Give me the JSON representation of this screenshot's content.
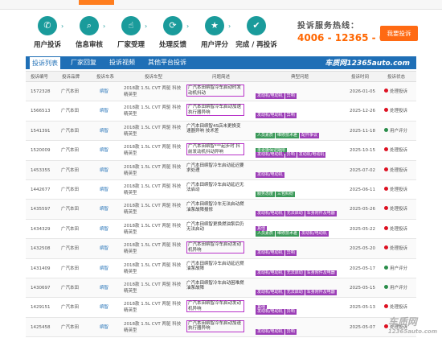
{
  "process": {
    "steps": [
      {
        "label": "用户投诉",
        "icon": "phone-icon"
      },
      {
        "label": "信息审核",
        "icon": "search-icon"
      },
      {
        "label": "厂家受理",
        "icon": "hand-icon"
      },
      {
        "label": "处理反馈",
        "icon": "refresh-icon"
      },
      {
        "label": "用户评分",
        "icon": "star-icon"
      },
      {
        "label": "完成 / 再投诉",
        "icon": "check-icon"
      }
    ],
    "hotline_title": "投诉服务热线：",
    "hotline_number": "4006 - 12365 - 0",
    "complain_button": "我要投诉"
  },
  "tabs": [
    "投诉列表",
    "厂家回复",
    "投诉视频",
    "其他平台投诉"
  ],
  "brand": "车质网12365auto.com",
  "columns": [
    "投诉编号",
    "投诉品牌",
    "投诉车系",
    "投诉车型",
    "问题简述",
    "典型问题",
    "投诉时间",
    "投诉状态"
  ],
  "rows": [
    {
      "id": "1572328",
      "brand": "广汽本田",
      "series": "缤智",
      "model": "2018款 1.5L CVT 两驱 科技精英型",
      "issue": "广汽本田缤智冷车启动时发动机抖动",
      "hl": true,
      "tags": [
        {
          "t": "发动机/电动机",
          "c": "purple"
        },
        {
          "t": "异响",
          "c": "purple"
        }
      ],
      "date": "2026-01-05",
      "status": "处理投诉"
    },
    {
      "id": "1566513",
      "brand": "广汽本田",
      "series": "缤智",
      "model": "2018款 1.5L CVT 两驱 科技精英型",
      "issue": "广汽本田缤智冷车启动加速执行器异响",
      "hl": true,
      "tags": [
        {
          "t": "发动机/电动机",
          "c": "purple"
        },
        {
          "t": "异响",
          "c": "purple"
        }
      ],
      "date": "2025-12-26",
      "status": "处理投诉"
    },
    {
      "id": "1541391",
      "brand": "广汽本田",
      "series": "缤智",
      "model": "2018款 1.5L CVT 两驱 科技精英型",
      "issue": "广汽本田缤智4S店未更换变速器异响 技术差",
      "hl": false,
      "tags": [
        {
          "t": "人员素质",
          "c": "green"
        },
        {
          "t": "维修技术差",
          "c": "green"
        },
        {
          "t": "配件争议",
          "c": "purple"
        },
        {
          "t": "未更换保证期限",
          "c": "green"
        }
      ],
      "date": "2025-11-18",
      "status": "用户评分"
    },
    {
      "id": "1520009",
      "brand": "广汽本田",
      "series": "缤智",
      "model": "2018款 1.5L CVT 两驱 科技精英型",
      "issue": "广汽本田缤智***起步时 抖 前发动机抖动异响",
      "hl": true,
      "tags": [
        {
          "t": "发动机/电动机",
          "c": "purple"
        },
        {
          "t": "异响",
          "c": "purple"
        },
        {
          "t": "发动机/电动机",
          "c": "purple"
        },
        {
          "t": "发动机启动困难",
          "c": "purple"
        }
      ],
      "date": "2025-10-15",
      "status": "处理投诉"
    },
    {
      "id": "1453355",
      "brand": "广汽本田",
      "series": "缤智",
      "model": "2018款 1.5L CVT 两驱 科技精英型",
      "issue": "广汽本田缤智冷车启动延迟要求处理",
      "hl": false,
      "tags": [
        {
          "t": "发动机/电动机",
          "c": "purple"
        }
      ],
      "date": "2025-07-02",
      "status": "处理投诉"
    },
    {
      "id": "1442677",
      "brand": "广汽本田",
      "series": "缤智",
      "model": "2018款 1.5L CVT 两驱 科技精英型",
      "issue": "广汽本田缤智冷车启动延迟无法启动",
      "hl": false,
      "tags": [
        {
          "t": "服务态度",
          "c": "green"
        },
        {
          "t": "三包纠纷",
          "c": "green"
        }
      ],
      "date": "2025-06-11",
      "status": "处理投诉"
    },
    {
      "id": "1435597",
      "brand": "广汽本田",
      "series": "缤智",
      "model": "2018款 1.5L CVT 两驱 科技精英型",
      "issue": "广汽本田缤智冷车无法启动燃油泵故障报修",
      "hl": false,
      "tags": [
        {
          "t": "发动机/电动机",
          "c": "purple"
        },
        {
          "t": "无法启动",
          "c": "purple"
        },
        {
          "t": "车身附件及电器",
          "c": "purple"
        },
        {
          "t": "其他",
          "c": "purple"
        }
      ],
      "date": "2025-05-26",
      "status": "处理投诉"
    },
    {
      "id": "1434329",
      "brand": "广汽本田",
      "series": "缤智",
      "model": "2018款 1.5L CVT 两驱 科技精英型",
      "issue": "广汽本田缤智更换燃油泵后仍无法启动",
      "hl": false,
      "tags": [
        {
          "t": "人员素质",
          "c": "green"
        },
        {
          "t": "维修技术差",
          "c": "green"
        },
        {
          "t": "发动机/电动机",
          "c": "purple"
        },
        {
          "t": "无法启动",
          "c": "purple"
        }
      ],
      "date": "2025-05-22",
      "status": "处理投诉"
    },
    {
      "id": "1432508",
      "brand": "广汽本田",
      "series": "缤智",
      "model": "2018款 1.5L CVT 两驱 科技精英型",
      "issue": "广汽本田缤智冷车启动发动机异响",
      "hl": true,
      "tags": [
        {
          "t": "发动机/电动机",
          "c": "purple"
        },
        {
          "t": "异响",
          "c": "purple"
        }
      ],
      "date": "2025-05-20",
      "status": "处理投诉"
    },
    {
      "id": "1431409",
      "brand": "广汽本田",
      "series": "缤智",
      "model": "2018款 1.5L CVT 两驱 科技精英型",
      "issue": "广汽本田缤智冷车启动延迟燃油泵故障",
      "hl": false,
      "tags": [
        {
          "t": "发动机/电动机",
          "c": "purple"
        },
        {
          "t": "无法启动",
          "c": "purple"
        },
        {
          "t": "车身附件及电器",
          "c": "purple"
        },
        {
          "t": "其他",
          "c": "purple"
        }
      ],
      "date": "2025-05-17",
      "status": "用户评分"
    },
    {
      "id": "1430697",
      "brand": "广汽本田",
      "series": "缤智",
      "model": "2018款 1.5L CVT 两驱 科技精英型",
      "issue": "广汽本田缤智冷车启动困难燃油泵故障",
      "hl": false,
      "tags": [
        {
          "t": "发动机/电动机",
          "c": "purple"
        },
        {
          "t": "无法启动",
          "c": "purple"
        },
        {
          "t": "车身附件及电器",
          "c": "purple"
        },
        {
          "t": "其他",
          "c": "purple"
        }
      ],
      "date": "2025-05-15",
      "status": "用户评分"
    },
    {
      "id": "1429151",
      "brand": "广汽本田",
      "series": "缤智",
      "model": "2018款 1.5L CVT 两驱 科技精英型",
      "issue": "广汽本田缤智冷车启动发动机异响",
      "hl": true,
      "tags": [
        {
          "t": "发动机/电动机",
          "c": "purple"
        },
        {
          "t": "异响",
          "c": "purple"
        }
      ],
      "date": "2025-05-13",
      "status": "处理投诉"
    },
    {
      "id": "1425458",
      "brand": "广汽本田",
      "series": "缤智",
      "model": "2018款 1.5L CVT 两驱 科技精英型",
      "issue": "广汽本田缤智冷车启动加速执行器异响",
      "hl": true,
      "tags": [
        {
          "t": "发动机/电动机",
          "c": "purple"
        },
        {
          "t": "异响",
          "c": "purple"
        }
      ],
      "date": "2025-05-07",
      "status": "处理投诉"
    }
  ],
  "watermark": {
    "top": "车质网",
    "bottom": "12365auto.com"
  }
}
